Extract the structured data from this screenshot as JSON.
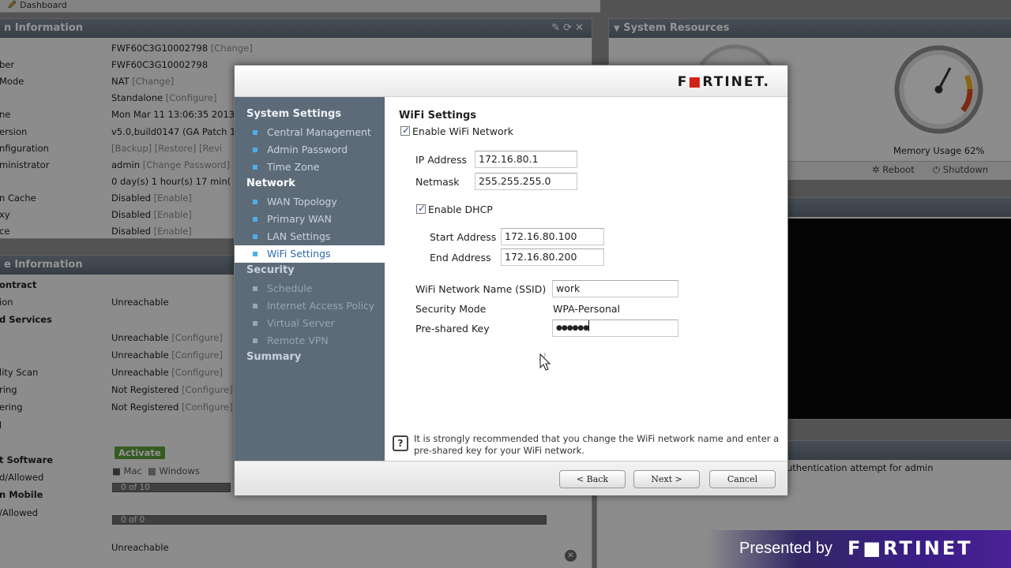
{
  "background": {
    "dashboard_link": "Dashboard",
    "sysinfo": {
      "title": "n Information",
      "rows": [
        {
          "k": "",
          "v": "FWF60C3G10002798",
          "l": "[Change]"
        },
        {
          "k": "ber",
          "v": "FWF60C3G10002798",
          "l": ""
        },
        {
          "k": "Mode",
          "v": "NAT",
          "l": "[Change]"
        },
        {
          "k": "",
          "v": "Standalone",
          "l": "[Configure]"
        },
        {
          "k": "ne",
          "v": "Mon Mar 11 13:06:35 2013",
          "l": ""
        },
        {
          "k": "ersion",
          "v": "v5.0,build0147 (GA Patch 1",
          "l": ""
        },
        {
          "k": "nfiguration",
          "v": "",
          "l": "[Backup]  [Restore]  [Revi"
        },
        {
          "k": "ministrator",
          "v": "admin",
          "l": "[Change Password]"
        },
        {
          "k": "",
          "v": "0 day(s) 1 hour(s) 17 min(",
          "l": ""
        },
        {
          "k": "n Cache",
          "v": "Disabled",
          "l": "[Enable]"
        },
        {
          "k": "xy",
          "v": "Disabled",
          "l": "[Enable]"
        },
        {
          "k": "ce",
          "v": "Disabled",
          "l": "[Enable]"
        }
      ]
    },
    "license": {
      "title": "e Information",
      "rows": [
        {
          "k": "ontract",
          "v": "",
          "l": "",
          "b": true
        },
        {
          "k": "ion",
          "v": "Unreachable",
          "l": ""
        },
        {
          "k": "d Services",
          "v": "",
          "l": "",
          "b": true
        },
        {
          "k": "",
          "v": "Unreachable",
          "l": "[Configure]"
        },
        {
          "k": "",
          "v": "Unreachable",
          "l": "[Configure]"
        },
        {
          "k": "lity Scan",
          "v": "Unreachable",
          "l": "[Configure]"
        },
        {
          "k": "ring",
          "v": "Not Registered",
          "l": "[Configure]"
        },
        {
          "k": "ering",
          "v": "Not Registered",
          "l": "[Configure]"
        },
        {
          "k": "l",
          "v": "",
          "l": ""
        },
        {
          "k": "",
          "v": "",
          "l": ""
        },
        {
          "k": "t Software",
          "v": "",
          "l": "",
          "b": true
        },
        {
          "k": "d/Allowed",
          "v": "",
          "l": ""
        },
        {
          "k": "n Mobile",
          "v": "",
          "l": "",
          "b": true
        },
        {
          "k": "/Allowed",
          "v": "",
          "l": ""
        },
        {
          "k": "",
          "v": "",
          "l": ""
        },
        {
          "k": "",
          "v": "Unreachable",
          "l": ""
        }
      ],
      "activate": "Activate",
      "mac": "Mac",
      "windows": "Windows",
      "bar1": "0 of 10",
      "bar2": "0 of 0"
    },
    "resources": {
      "title": "System Resources",
      "memory_usage": "Memory Usage 62%",
      "reboot": "Reboot",
      "shutdown": "Shutdown"
    },
    "log_text": "uthentication attempt for admin"
  },
  "dialog": {
    "logo_parts": [
      "F",
      "■",
      "RTINET",
      "."
    ],
    "nav": {
      "system_settings": "System Settings",
      "central_mgmt": "Central Management",
      "admin_password": "Admin Password",
      "time_zone": "Time Zone",
      "network": "Network",
      "wan_topology": "WAN Topology",
      "primary_wan": "Primary WAN",
      "lan_settings": "LAN Settings",
      "wifi_settings": "WiFi Settings",
      "security": "Security",
      "schedule": "Schedule",
      "internet_access_policy": "Internet Access Policy",
      "virtual_server": "Virtual Server",
      "remote_vpn": "Remote VPN",
      "summary": "Summary"
    },
    "content": {
      "title": "WiFi Settings",
      "enable_wifi": "Enable WiFi Network",
      "ip_label": "IP Address",
      "ip_value": "172.16.80.1",
      "netmask_label": "Netmask",
      "netmask_value": "255.255.255.0",
      "enable_dhcp": "Enable DHCP",
      "start_label": "Start Address",
      "start_value": "172.16.80.100",
      "end_label": "End Address",
      "end_value": "172.16.80.200",
      "ssid_label": "WiFi Network Name (SSID)",
      "ssid_value": "work",
      "secmode_label": "Security Mode",
      "secmode_value": "WPA-Personal",
      "psk_label": "Pre-shared Key",
      "psk_value": "●●●●●●",
      "note_icon": "?",
      "note": "It is strongly recommended that you change the WiFi network name and enter a pre-shared key for your WiFi network."
    },
    "buttons": {
      "back": "< Back",
      "next": "Next >",
      "cancel": "Cancel"
    }
  },
  "branding": {
    "presented_by": "Presented by",
    "logo": "F■RTINET"
  }
}
